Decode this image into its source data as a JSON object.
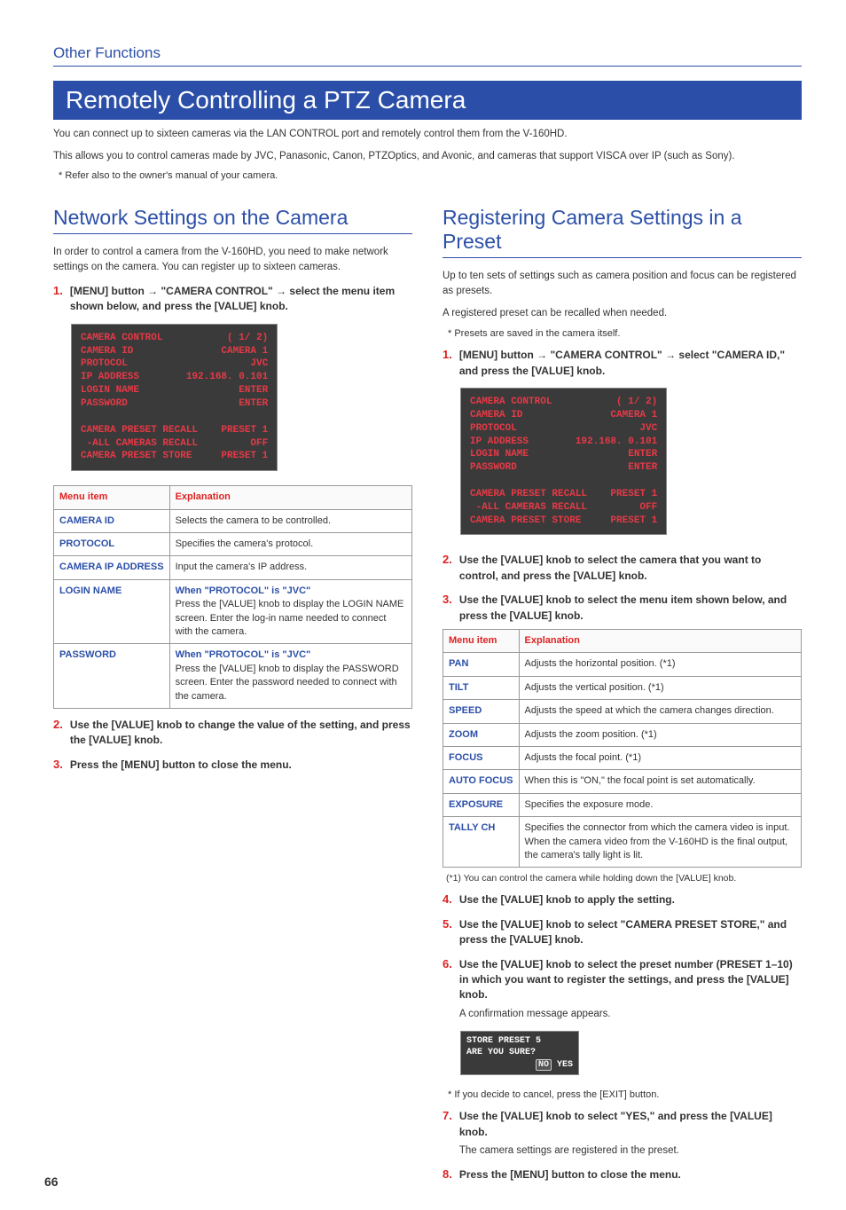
{
  "breadcrumb": "Other Functions",
  "hero_title": "Remotely Controlling a PTZ Camera",
  "intro_line1": "You can connect up to sixteen cameras via the LAN CONTROL port and remotely control them from the V-160HD.",
  "intro_line2": "This allows you to control cameras made by JVC, Panasonic, Canon, PTZOptics, and Avonic, and cameras that support VISCA over IP (such as Sony).",
  "intro_note": "* Refer also to the owner's manual of your camera.",
  "leftcol": {
    "title": "Network Settings on the Camera",
    "intro": "In order to control a camera from the V-160HD, you need to make network settings on the camera. You can register up to sixteen cameras.",
    "step1_num": "1.",
    "step1_text_a": "[MENU] button ",
    "step1_text_b": " \"CAMERA CONTROL\" ",
    "step1_text_c": " select the menu item shown below, and press the [VALUE] knob.",
    "terminal": "CAMERA CONTROL           ( 1/ 2)\nCAMERA ID               CAMERA 1\nPROTOCOL                     JVC\nIP ADDRESS        192.168. 0.101\nLOGIN NAME                 ENTER\nPASSWORD                   ENTER\n\nCAMERA PRESET RECALL    PRESET 1\n -ALL CAMERAS RECALL         OFF\nCAMERA PRESET STORE     PRESET 1",
    "table_header_item": "Menu item",
    "table_header_expl": "Explanation",
    "rows": [
      {
        "label": "CAMERA ID",
        "expl": "Selects the camera to be controlled."
      },
      {
        "label": "PROTOCOL",
        "expl": "Specifies the camera's protocol."
      },
      {
        "label": "CAMERA IP ADDRESS",
        "expl": "Input the camera's IP address."
      },
      {
        "label": "LOGIN NAME",
        "cond": "When \"PROTOCOL\" is \"JVC\"",
        "expl": "Press the [VALUE] knob to display the LOGIN NAME screen. Enter the log-in name needed to connect with the camera."
      },
      {
        "label": "PASSWORD",
        "cond": "When \"PROTOCOL\" is \"JVC\"",
        "expl": "Press the [VALUE] knob to display the PASSWORD screen. Enter the password needed to connect with the camera."
      }
    ],
    "step2_num": "2.",
    "step2_text": "Use the [VALUE] knob to change the value of the setting, and press the [VALUE] knob.",
    "step3_num": "3.",
    "step3_text": "Press the [MENU] button to close the menu."
  },
  "rightcol": {
    "title": "Registering Camera Settings in a Preset",
    "intro1": "Up to ten sets of settings such as camera position and focus can be registered as presets.",
    "intro2": "A registered preset can be recalled when needed.",
    "intro_note": "* Presets are saved in the camera itself.",
    "step1_num": "1.",
    "step1_text_a": "[MENU] button ",
    "step1_text_b": " \"CAMERA CONTROL\" ",
    "step1_text_c": " select \"CAMERA ID,\" and press the [VALUE] knob.",
    "terminal": "CAMERA CONTROL           ( 1/ 2)\nCAMERA ID               CAMERA 1\nPROTOCOL                     JVC\nIP ADDRESS        192.168. 0.101\nLOGIN NAME                 ENTER\nPASSWORD                   ENTER\n\nCAMERA PRESET RECALL    PRESET 1\n -ALL CAMERAS RECALL         OFF\nCAMERA PRESET STORE     PRESET 1",
    "step2_num": "2.",
    "step2_text": "Use the [VALUE] knob to select the camera that you want to control, and press the [VALUE] knob.",
    "step3_num": "3.",
    "step3_text": "Use the [VALUE] knob to select the menu item shown below, and press the [VALUE] knob.",
    "table_header_item": "Menu item",
    "table_header_expl": "Explanation",
    "rows": [
      {
        "label": "PAN",
        "expl": "Adjusts the horizontal position. (*1)"
      },
      {
        "label": "TILT",
        "expl": "Adjusts the vertical position. (*1)"
      },
      {
        "label": "SPEED",
        "expl": "Adjusts the speed at which the camera changes direction."
      },
      {
        "label": "ZOOM",
        "expl": "Adjusts the zoom position. (*1)"
      },
      {
        "label": "FOCUS",
        "expl": "Adjusts the focal point. (*1)"
      },
      {
        "label": "AUTO FOCUS",
        "expl": "When this is \"ON,\" the focal point is set automatically."
      },
      {
        "label": "EXPOSURE",
        "expl": "Specifies the exposure mode."
      },
      {
        "label": "TALLY CH",
        "expl": "Specifies the connector from which the camera video is input. When the camera video from the V-160HD is the final output, the camera's tally light is lit."
      }
    ],
    "footnote1": "(*1) You can control the camera while holding down the [VALUE] knob.",
    "step4_num": "4.",
    "step4_text": "Use the [VALUE] knob to apply the setting.",
    "step5_num": "5.",
    "step5_text": "Use the [VALUE] knob to select \"CAMERA PRESET STORE,\" and press the [VALUE] knob.",
    "step6_num": "6.",
    "step6_text": "Use the [VALUE] knob to select the preset number (PRESET 1–10) in which you want to register the settings, and press the [VALUE] knob.",
    "step6_sub": "A confirmation message appears.",
    "confirm_terminal_line1": "STORE PRESET 5",
    "confirm_terminal_line2": "ARE YOU SURE?",
    "confirm_terminal_no": "NO",
    "confirm_terminal_yes": " YES",
    "cancel_note": "* If you decide to cancel, press the [EXIT] button.",
    "step7_num": "7.",
    "step7_text": "Use the [VALUE] knob to select \"YES,\" and press the [VALUE] knob.",
    "step7_sub": "The camera settings are registered in the preset.",
    "step8_num": "8.",
    "step8_text": "Press the [MENU] button to close the menu."
  },
  "page_number": "66"
}
